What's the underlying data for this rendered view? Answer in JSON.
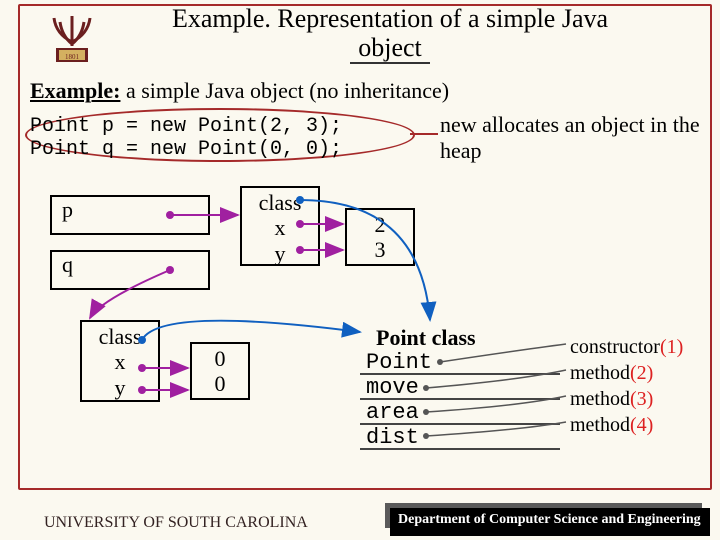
{
  "title_line1": "Example. Representation of a simple Java",
  "title_line2": "object",
  "example_label": "Example:",
  "example_text": " a simple Java object (no inheritance)",
  "code_snippet": "Point p = new Point(2, 3);\nPoint q = new Point(0, 0);",
  "annotation": "new allocates an object in the heap",
  "p_label": "p",
  "q_label": "q",
  "obj_class_label": "class",
  "obj_x_label": "x",
  "obj_y_label": "y",
  "val_2": "2",
  "val_3": "3",
  "zero_a": "0",
  "zero_b": "0",
  "point_class_title": "Point class",
  "point_code": "Point\nmove\narea\ndist",
  "methods": {
    "m1": "constructor",
    "n1": "(1)",
    "m2": "method",
    "n2": "(2)",
    "m3": "method",
    "n3": "(3)",
    "m4": "method",
    "n4": "(4)"
  },
  "footer_left": "UNIVERSITY OF SOUTH CAROLINA",
  "footer_right": "Department of Computer Science and Engineering"
}
